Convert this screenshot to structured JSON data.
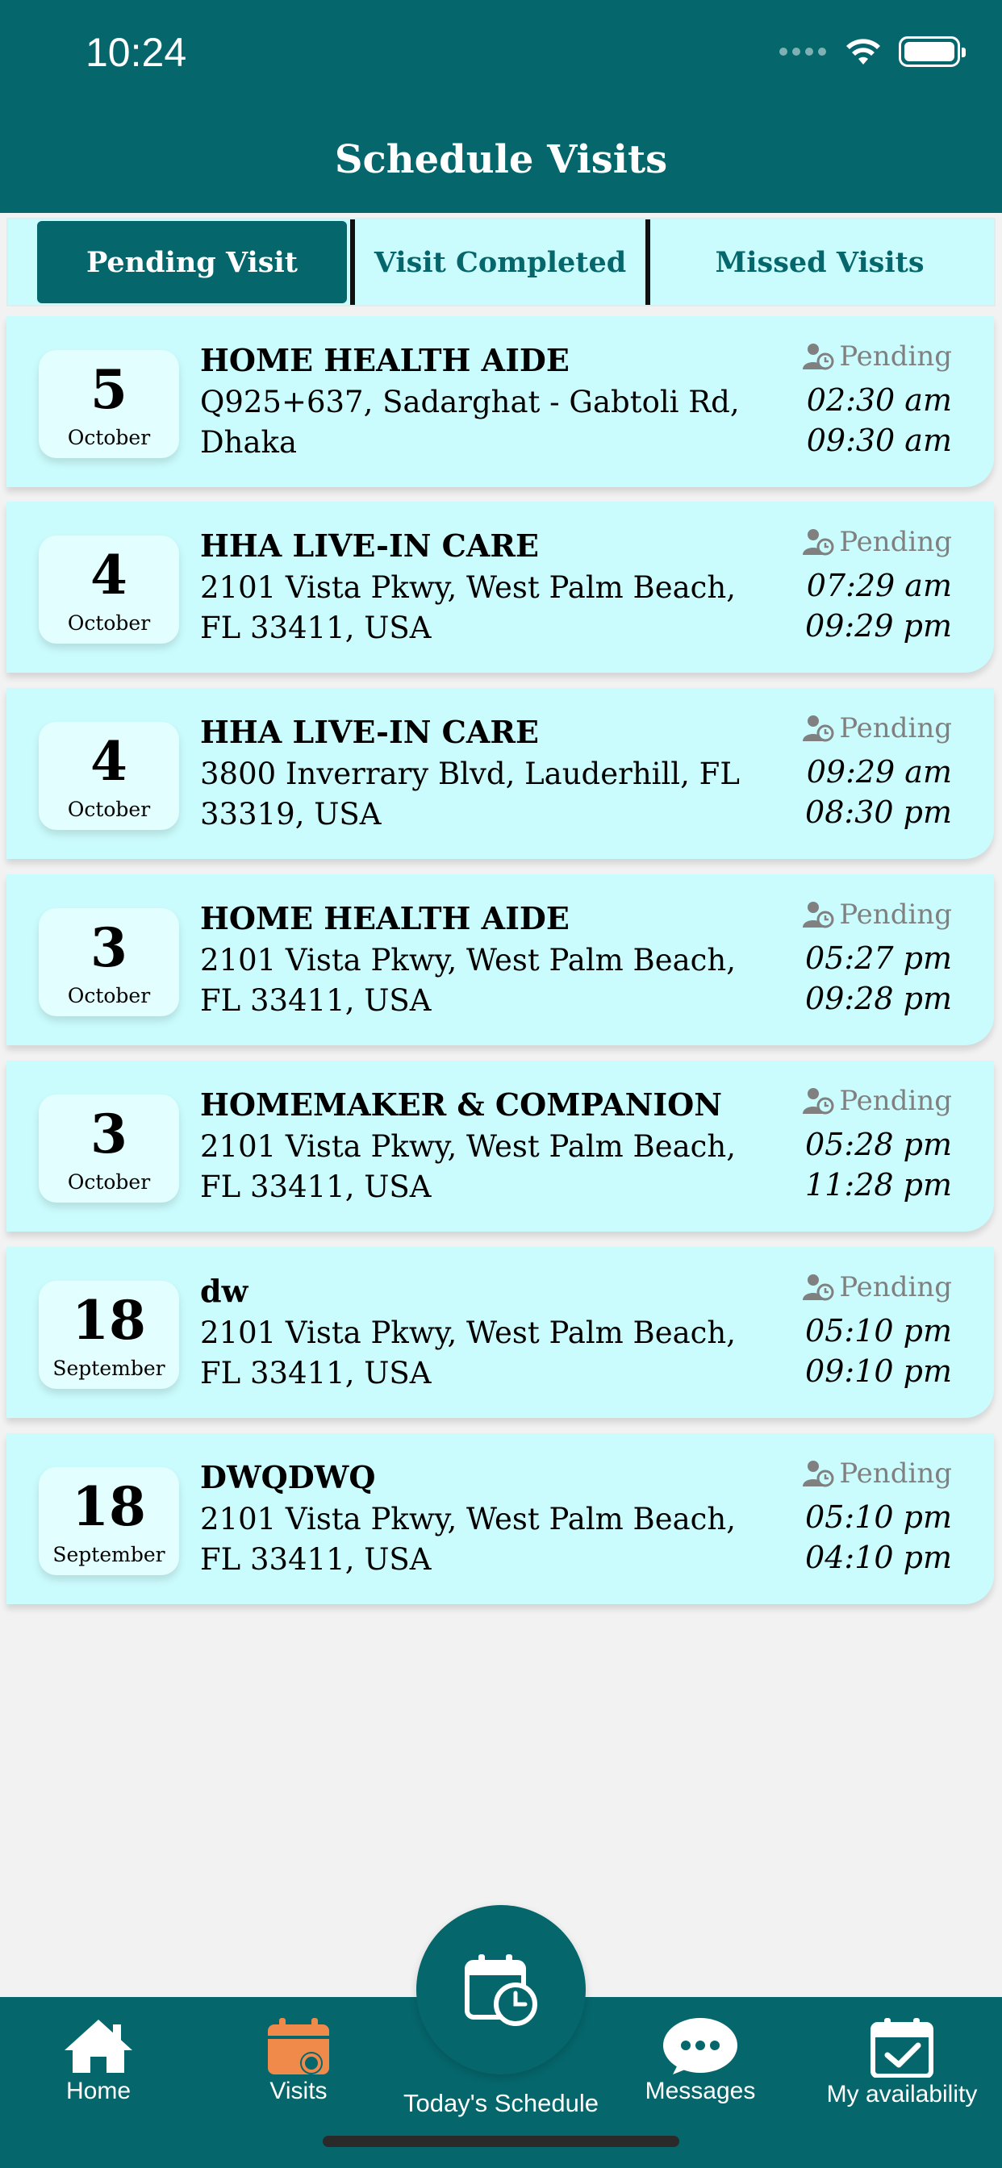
{
  "status_bar": {
    "time": "10:24"
  },
  "header": {
    "title": "Schedule Visits"
  },
  "tabs": [
    {
      "label": "Pending Visit",
      "active": true
    },
    {
      "label": "Visit Completed",
      "active": false
    },
    {
      "label": "Missed Visits",
      "active": false
    }
  ],
  "visits": [
    {
      "day": "5",
      "month": "October",
      "title": "HOME HEALTH AIDE",
      "address": "Q925+637, Sadarghat - Gabtoli Rd, Dhaka",
      "status": "Pending",
      "start": "02:30 am",
      "end": "09:30 am"
    },
    {
      "day": "4",
      "month": "October",
      "title": "HHA LIVE-IN CARE",
      "address": "2101 Vista Pkwy, West Palm Beach, FL 33411, USA",
      "status": "Pending",
      "start": "07:29 am",
      "end": "09:29 pm"
    },
    {
      "day": "4",
      "month": "October",
      "title": "HHA LIVE-IN CARE",
      "address": "3800 Inverrary Blvd, Lauderhill, FL 33319, USA",
      "status": "Pending",
      "start": "09:29 am",
      "end": "08:30 pm"
    },
    {
      "day": "3",
      "month": "October",
      "title": "HOME HEALTH AIDE",
      "address": "2101 Vista Pkwy, West Palm Beach, FL 33411, USA",
      "status": "Pending",
      "start": "05:27 pm",
      "end": "09:28 pm"
    },
    {
      "day": "3",
      "month": "October",
      "title": "HOMEMAKER & COMPANION",
      "address": "2101 Vista Pkwy, West Palm Beach, FL 33411, USA",
      "status": "Pending",
      "start": "05:28 pm",
      "end": "11:28 pm"
    },
    {
      "day": "18",
      "month": "September",
      "title": "dw",
      "address": "2101 Vista Pkwy, West Palm Beach, FL 33411, USA",
      "status": "Pending",
      "start": "05:10 pm",
      "end": "09:10 pm"
    },
    {
      "day": "18",
      "month": "September",
      "title": "DWQDWQ",
      "address": "2101 Vista Pkwy, West Palm Beach, FL 33411, USA",
      "status": "Pending",
      "start": "05:10 pm",
      "end": "04:10 pm"
    }
  ],
  "bottom_nav": {
    "home": "Home",
    "visits": "Visits",
    "today": "Today's Schedule",
    "messages": "Messages",
    "availability": "My availability"
  },
  "colors": {
    "primary": "#05666b",
    "card_bg": "#cbfcfd",
    "accent_orange": "#f08a4b",
    "status_gray": "#808080"
  },
  "icons": {
    "status": "user-clock-icon",
    "home": "home-icon",
    "visits": "calendar-icon",
    "today": "calendar-clock-icon",
    "messages": "chat-bubble-icon",
    "availability": "calendar-check-icon"
  }
}
